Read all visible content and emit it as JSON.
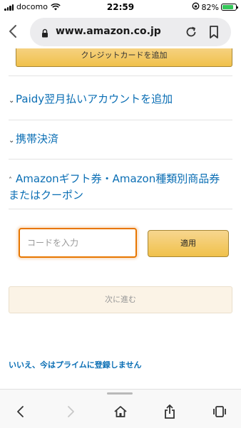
{
  "status_bar": {
    "carrier": "docomo",
    "time": "22:59",
    "battery": "82%",
    "battery_level": 0.82
  },
  "browser": {
    "url": "www.amazon.co.jp"
  },
  "payment": {
    "add_card_label": "クレジットカードを追加",
    "paidy_label": "Paidy翌月払いアカウントを追加",
    "carrier_billing_label": "携帯決済",
    "gift_card_label": "Amazonギフト券・Amazon種類別商品券またはクーポン",
    "code_placeholder": "コードを入力",
    "apply_label": "適用",
    "next_label": "次に進む",
    "no_prime_label": "いいえ、今はプライムに登録しません"
  },
  "colors": {
    "link": "#0a6eb4",
    "button_gold": "#f0c14b",
    "focus_orange": "#e77600"
  }
}
